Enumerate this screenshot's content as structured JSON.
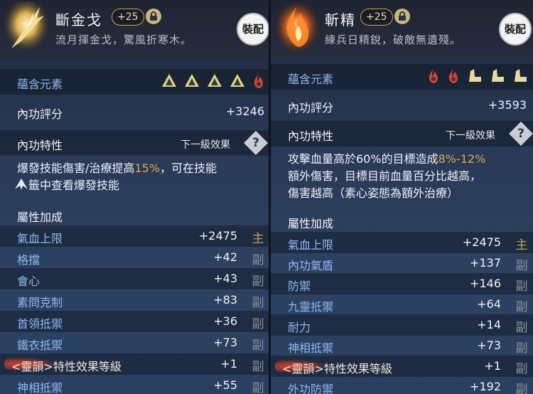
{
  "left": {
    "title": "斷金戈",
    "plus_level": "+25",
    "subtitle": "流月揮金戈，驚風折寒木。",
    "equip_label": "裝配",
    "elements_label": "蘊含元素",
    "elements_icons": [
      "metal-triangle",
      "metal-triangle",
      "metal-triangle",
      "metal-triangle",
      "fire-flame"
    ],
    "score_label": "內功評分",
    "score_value": "+3246",
    "trait_label": "內功特性",
    "next_level_label": "下一級效果",
    "desc_line1_a": "爆發技能傷害/治療提高",
    "desc_line1_hl": "15%",
    "desc_line1_b": "，可在技能",
    "desc_line2": "籤中查看爆發技能",
    "attr_header": "屬性加成",
    "stats": [
      {
        "name": "氣血上限",
        "value": "+2475",
        "tag": "主"
      },
      {
        "name": "格擋",
        "value": "+42",
        "tag": "副"
      },
      {
        "name": "會心",
        "value": "+43",
        "tag": "副"
      },
      {
        "name": "素問克制",
        "value": "+83",
        "tag": "副"
      },
      {
        "name": "首領抵禦",
        "value": "+36",
        "tag": "副"
      },
      {
        "name": "鐵衣抵禦",
        "value": "+73",
        "tag": "副"
      },
      {
        "name": "<靈韻>特性效果等級",
        "value": "+1",
        "tag": "副"
      },
      {
        "name": "神相抵禦",
        "value": "+55",
        "tag": "副"
      }
    ]
  },
  "right": {
    "title": "斬精",
    "plus_level": "+25",
    "subtitle": "練兵日精銳，破敵無遺殘。",
    "equip_label": "裝配",
    "elements_label": "蘊含元素",
    "elements_icons": [
      "fire-flame",
      "fire-flame",
      "fan",
      "fan",
      "fan"
    ],
    "score_label": "內功評分",
    "score_value": "+3593",
    "trait_label": "內功特性",
    "next_level_label": "下一級效果",
    "desc_line1_a": "攻擊血量高於60%的目標造成",
    "desc_line1_hl": "8%-12%",
    "desc_line2": "額外傷害，目標目前血量百分比越高，",
    "desc_line3": "傷害越高（素心姿態為額外治療）",
    "attr_header": "屬性加成",
    "stats": [
      {
        "name": "氣血上限",
        "value": "+2475",
        "tag": "主"
      },
      {
        "name": "內功氣盾",
        "value": "+137",
        "tag": "副"
      },
      {
        "name": "防禦",
        "value": "+146",
        "tag": "副"
      },
      {
        "name": "九靈抵禦",
        "value": "+64",
        "tag": "副"
      },
      {
        "name": "耐力",
        "value": "+14",
        "tag": "副"
      },
      {
        "name": "神相抵禦",
        "value": "+73",
        "tag": "副"
      },
      {
        "name": "<靈韻>特性效果等級",
        "value": "+1",
        "tag": "副"
      },
      {
        "name": "外功防禦",
        "value": "+192",
        "tag": "副"
      }
    ]
  }
}
